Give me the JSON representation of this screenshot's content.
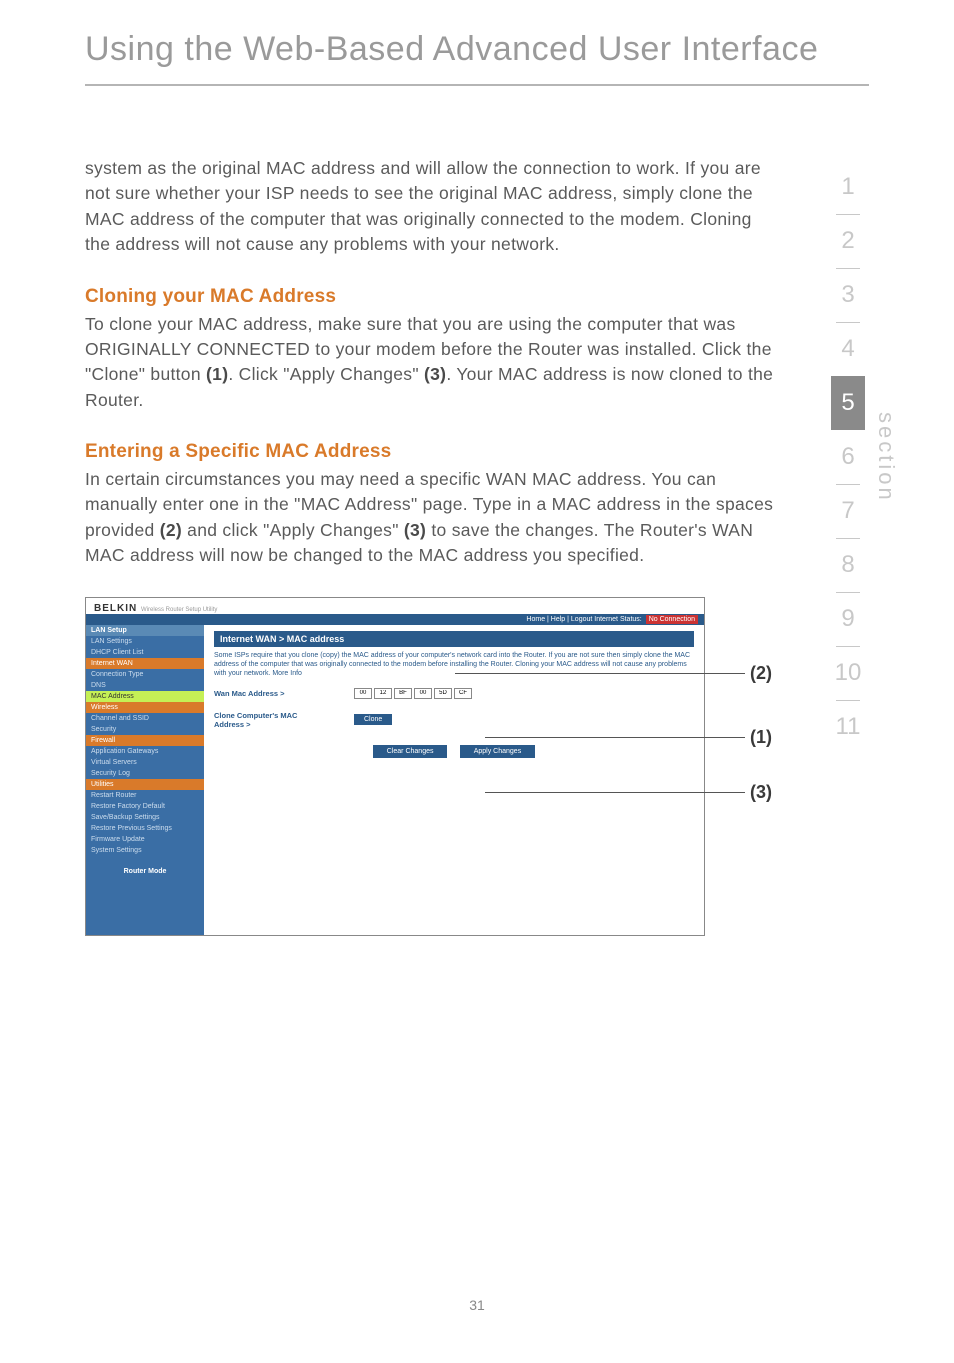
{
  "page_title": "Using the Web-Based Advanced User Interface",
  "intro_paragraph": "system as the original MAC address and will allow the connection to work. If you are not sure whether your ISP needs to see the original MAC address, simply clone the MAC address of the computer that was originally connected to the modem. Cloning the address will not cause any problems with your network.",
  "cloning": {
    "heading": "Cloning your MAC Address",
    "text_pre": "To clone your MAC address, make sure that you are using the computer that was ORIGINALLY CONNECTED to your modem before the Router was installed. Click the \"Clone\" button ",
    "ref1": "(1)",
    "text_mid": ". Click \"Apply Changes\" ",
    "ref3": "(3)",
    "text_post": ". Your MAC address is now cloned to the Router."
  },
  "entering": {
    "heading": "Entering a Specific MAC Address",
    "text_pre": "In certain circumstances you may need a specific WAN MAC address. You can manually enter one in the \"MAC Address\" page. Type in a MAC address in the spaces provided ",
    "ref2": "(2)",
    "text_mid": " and click \"Apply Changes\" ",
    "ref3": "(3)",
    "text_post": " to save the changes. The Router's WAN MAC address will now be changed to the MAC address you specified."
  },
  "section_nav": {
    "label": "section",
    "items": [
      "1",
      "2",
      "3",
      "4",
      "5",
      "6",
      "7",
      "8",
      "9",
      "10",
      "11"
    ],
    "active": "5"
  },
  "router_ui": {
    "brand": "BELKIN",
    "brand_sub": "Wireless Router Setup Utility",
    "status_links": "Home | Help | Logout   Internet Status:",
    "status_value": "No Connection",
    "nav": {
      "lan_setup": "LAN Setup",
      "lan_settings": "LAN Settings",
      "dhcp_client": "DHCP Client List",
      "internet_wan": "Internet WAN",
      "conn_type": "Connection Type",
      "dns": "DNS",
      "mac_address": "MAC Address",
      "wireless": "Wireless",
      "channel_ssid": "Channel and SSID",
      "security": "Security",
      "firewall": "Firewall",
      "app_gateways": "Application Gateways",
      "virtual_servers": "Virtual Servers",
      "security_log": "Security Log",
      "utilities": "Utilities",
      "restart": "Restart Router",
      "restore_defaults": "Restore Factory Default",
      "save_backup": "Save/Backup Settings",
      "restore_prev": "Restore Previous Settings",
      "firmware": "Firmware Update",
      "system": "System Settings",
      "router_mode": "Router Mode"
    },
    "main_title": "Internet WAN > MAC address",
    "main_desc": "Some ISPs require that you clone (copy) the MAC address of your computer's network card into the Router. If you are not sure then simply clone the MAC address of the computer that was originally connected to the modem before installing the Router. Cloning your MAC address will not cause any problems with your network. More Info",
    "wan_mac_label": "Wan Mac Address >",
    "mac_values": [
      "00",
      "12",
      "BF",
      "00",
      "5D"
    ],
    "mac_extra": "CF",
    "clone_label": "Clone Computer's MAC Address >",
    "btn_clone": "Clone",
    "btn_clear": "Clear Changes",
    "btn_apply": "Apply Changes"
  },
  "callouts": {
    "c1": "(1)",
    "c2": "(2)",
    "c3": "(3)"
  },
  "page_number": "31"
}
